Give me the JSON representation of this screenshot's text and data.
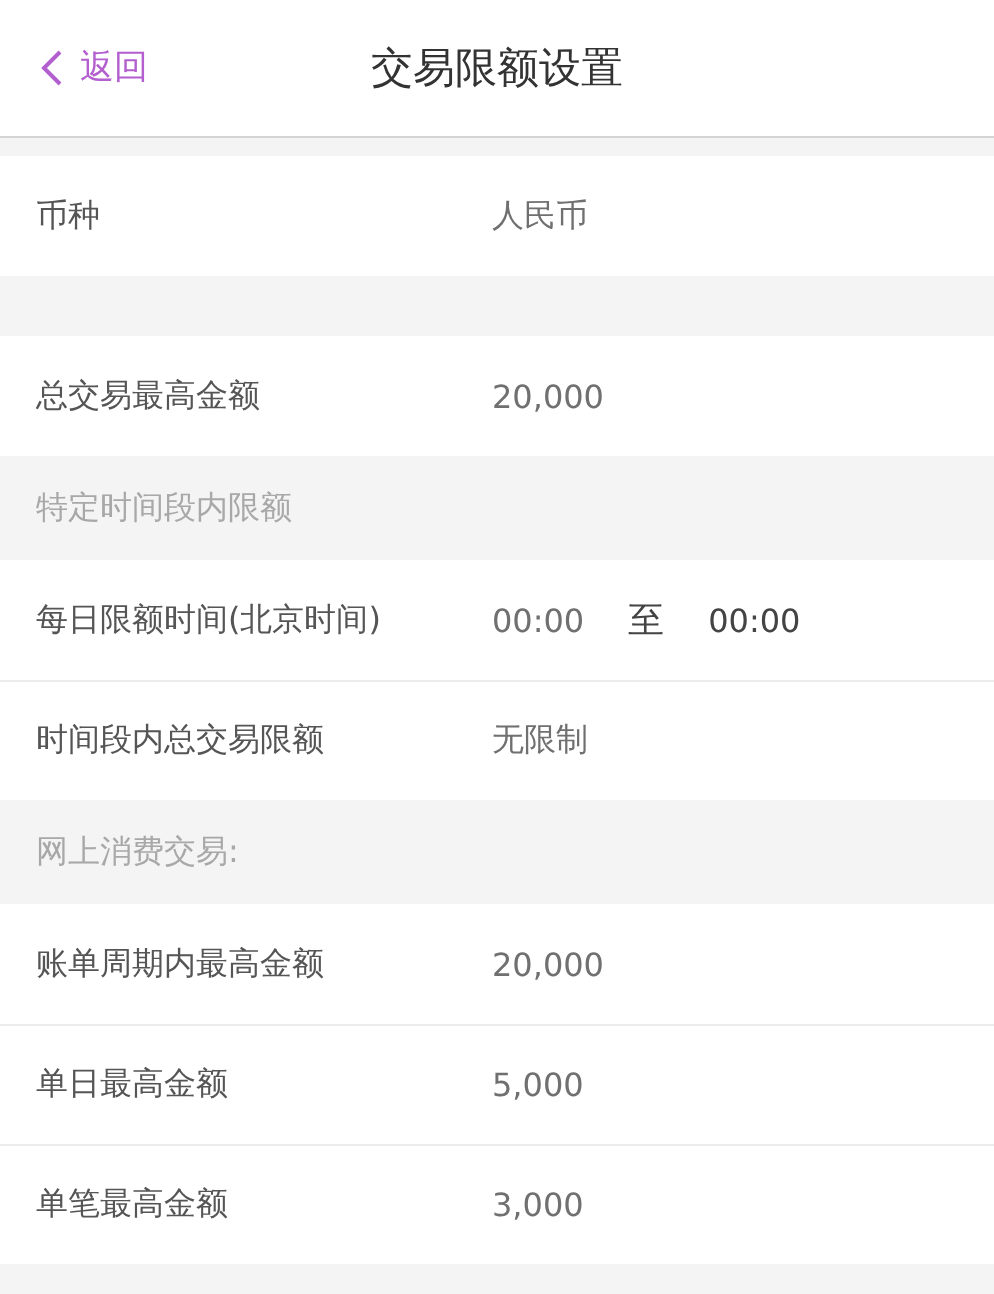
{
  "header": {
    "back": "返回",
    "title": "交易限额设置"
  },
  "groups": [
    {
      "rows": [
        {
          "kind": "text",
          "label": "币种",
          "value": "人民币"
        }
      ]
    },
    {
      "rows": [
        {
          "kind": "text",
          "label": "总交易最高金额",
          "value": "20,000"
        }
      ]
    },
    {
      "title": "特定时间段内限额",
      "rows": [
        {
          "kind": "range",
          "label": "每日限额时间(北京时间)",
          "from": "00:00",
          "sep": "至",
          "to": "00:00"
        },
        {
          "kind": "text",
          "label": "时间段内总交易限额",
          "value": "无限制"
        }
      ]
    },
    {
      "title": "网上消费交易:",
      "rows": [
        {
          "kind": "text",
          "label": "账单周期内最高金额",
          "value": "20,000"
        },
        {
          "kind": "text",
          "label": "单日最高金额",
          "value": "5,000"
        },
        {
          "kind": "text",
          "label": "单笔最高金额",
          "value": "3,000"
        }
      ]
    }
  ]
}
